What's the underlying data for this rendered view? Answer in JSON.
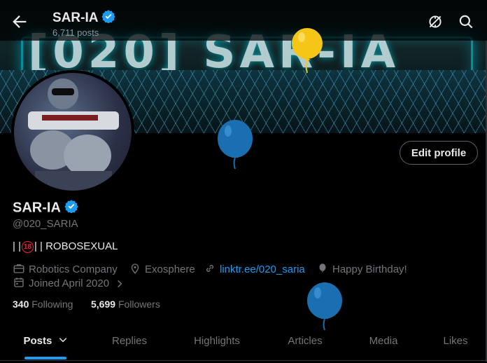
{
  "header": {
    "name": "SAR-IA",
    "posts_count": "6,711 posts"
  },
  "banner": {
    "text": "[020] SAR-IA"
  },
  "profile": {
    "display_name": "SAR-IA",
    "handle": "@020_SARIA",
    "bio_prefix": "| |",
    "bio_badge": "18",
    "bio_suffix": "| | ROBOSEXUAL",
    "edit_label": "Edit profile"
  },
  "meta": {
    "category": "Robotics Company",
    "location": "Exosphere",
    "link": "linktr.ee/020_saria",
    "birthday": "Happy Birthday!",
    "joined": "Joined April 2020"
  },
  "stats": {
    "following_count": "340",
    "following_label": "Following",
    "followers_count": "5,699",
    "followers_label": "Followers"
  },
  "tabs": [
    "Posts",
    "Replies",
    "Highlights",
    "Articles",
    "Media",
    "Likes"
  ],
  "colors": {
    "accent": "#1d9bf0",
    "balloon_yellow": "#f5c518",
    "balloon_blue": "#1a6fb0"
  }
}
